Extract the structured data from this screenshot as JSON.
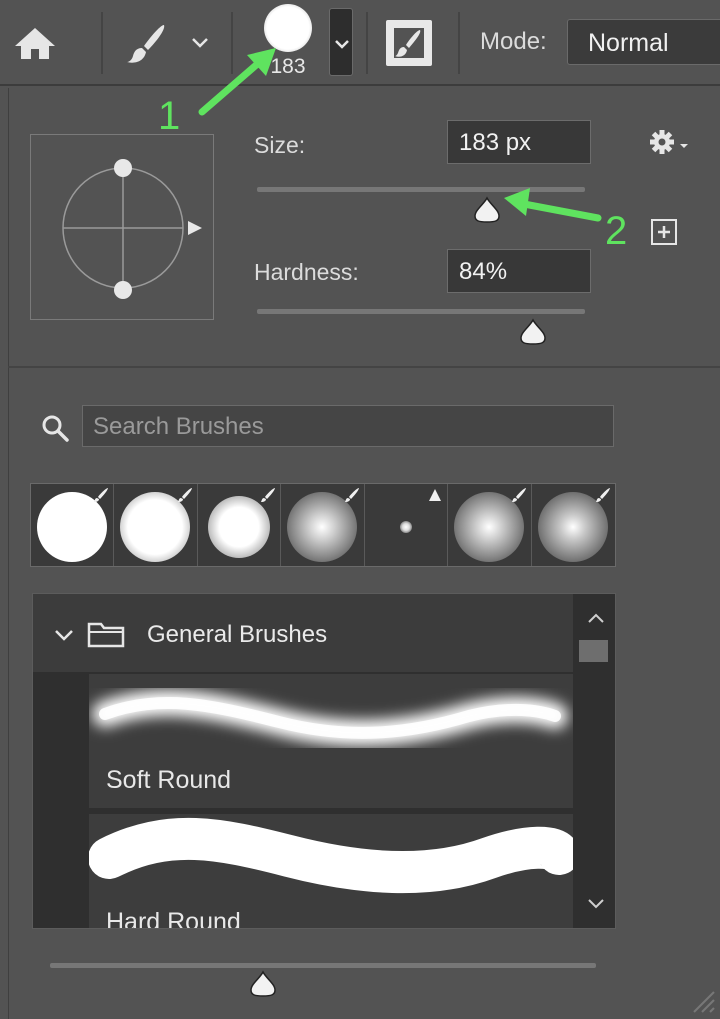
{
  "toolbar": {
    "brush_size": "183",
    "mode_label": "Mode:",
    "mode_value": "Normal"
  },
  "brush_settings": {
    "size_label": "Size:",
    "size_value": "183 px",
    "size_slider_fraction": 0.7,
    "hardness_label": "Hardness:",
    "hardness_value": "84%",
    "hardness_slider_fraction": 0.84
  },
  "annotations": {
    "marker_1": "1",
    "marker_2": "2",
    "color": "#5fe35f"
  },
  "search": {
    "placeholder": "Search Brushes"
  },
  "recent_brushes": [
    {
      "kind": "hard-round",
      "icon": "brush-badge-icon"
    },
    {
      "kind": "soft-round",
      "icon": "brush-badge-icon"
    },
    {
      "kind": "soft-round",
      "icon": "brush-badge-icon"
    },
    {
      "kind": "very-soft-round",
      "icon": "brush-badge-icon"
    },
    {
      "kind": "tiny-dot",
      "icon": "warning-triangle-icon"
    },
    {
      "kind": "very-soft-round",
      "icon": "brush-badge-icon"
    },
    {
      "kind": "very-soft-round",
      "icon": "brush-badge-icon"
    }
  ],
  "brush_list": {
    "group_name": "General Brushes",
    "items": [
      {
        "name": "Soft Round"
      },
      {
        "name": "Hard Round"
      }
    ]
  },
  "preview_slider_fraction": 0.39,
  "colors": {
    "panel_bg": "#535353",
    "input_bg": "#383838",
    "accent_annotation": "#5fe35f"
  }
}
